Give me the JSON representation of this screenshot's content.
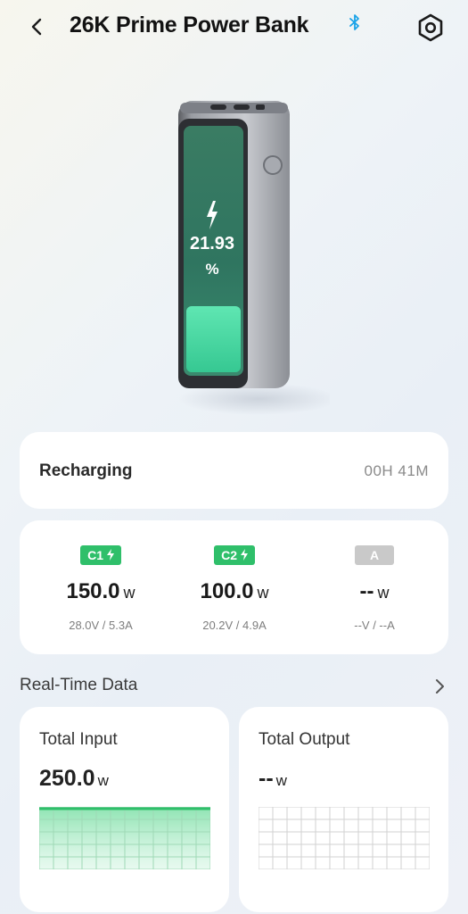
{
  "header": {
    "title": "26K Prime Power Bank",
    "back_icon": "chevron-left-icon",
    "bluetooth_icon": "bluetooth-icon",
    "settings_icon": "hexagon-gear-icon"
  },
  "device": {
    "battery_percent": "21.93",
    "percent_sign": "%",
    "charge_level": 0.2193,
    "accent_color": "#3ddc9c"
  },
  "status": {
    "label": "Recharging",
    "time": "00H 41M"
  },
  "ports": [
    {
      "badge": "C1",
      "power": "150.0",
      "unit": "w",
      "detail": "28.0V / 5.3A",
      "active": true
    },
    {
      "badge": "C2",
      "power": "100.0",
      "unit": "w",
      "detail": "20.2V / 4.9A",
      "active": true
    },
    {
      "badge": "A",
      "power": "--",
      "unit": "w",
      "detail": "--V / --A",
      "active": false
    }
  ],
  "realtime": {
    "title": "Real-Time Data",
    "input": {
      "label": "Total Input",
      "value": "250.0",
      "unit": "w"
    },
    "output": {
      "label": "Total Output",
      "value": "--",
      "unit": "w"
    }
  },
  "colors": {
    "active_green": "#2fbf6a",
    "inactive_gray": "#c9c9c9",
    "bluetooth_blue": "#1aa3e8"
  }
}
